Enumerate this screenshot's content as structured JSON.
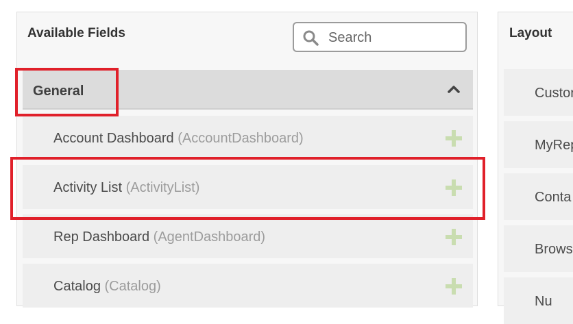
{
  "available_fields": {
    "title": "Available Fields",
    "search": {
      "placeholder": "Search",
      "value": ""
    },
    "group": {
      "label": "General",
      "fields": [
        {
          "label": "Account Dashboard",
          "code": "(AccountDashboard)"
        },
        {
          "label": "Activity List",
          "code": "(ActivityList)"
        },
        {
          "label": "Rep Dashboard",
          "code": "(AgentDashboard)"
        },
        {
          "label": "Catalog",
          "code": "(Catalog)"
        }
      ]
    }
  },
  "layout": {
    "title": "Layout",
    "items": [
      {
        "label": "Custor"
      },
      {
        "label": "MyRep"
      },
      {
        "label": "Conta"
      },
      {
        "label": "Brows"
      },
      {
        "label": "Nu"
      }
    ]
  },
  "colors": {
    "highlight": "#e0202a",
    "add_icon": "#c9ddb0"
  },
  "icons": {
    "search": "search-icon",
    "collapse": "chevron-up-icon",
    "add": "plus-icon"
  }
}
